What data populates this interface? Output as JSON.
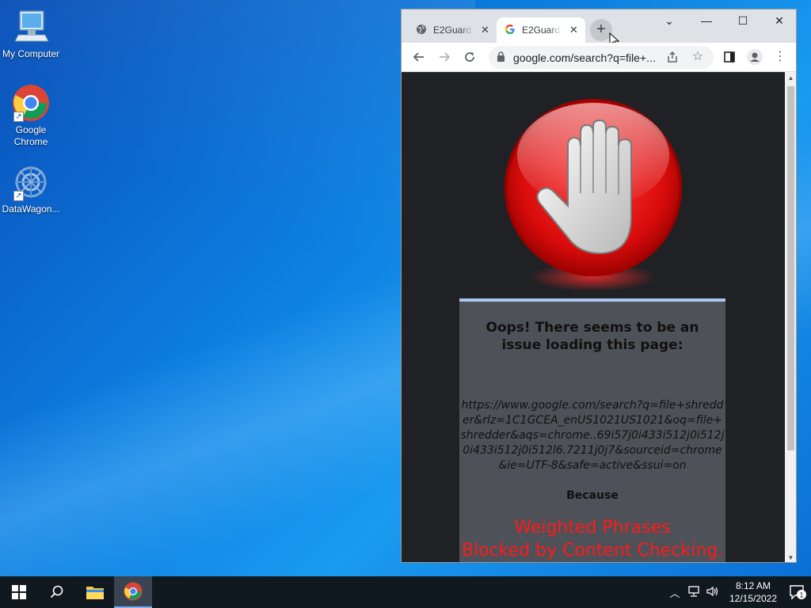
{
  "desktop": {
    "icons": [
      {
        "label": "My Computer",
        "icon": "computer-icon"
      },
      {
        "label": "Google Chrome",
        "icon": "chrome-icon"
      },
      {
        "label": "DataWagon...",
        "icon": "datawagon-icon"
      }
    ]
  },
  "browser": {
    "tabs": [
      {
        "title": "E2Guard",
        "icon": "globe-icon",
        "active": false
      },
      {
        "title": "E2Guard",
        "icon": "google-icon",
        "active": true
      }
    ],
    "new_tab": "+",
    "window_controls": {
      "dropdown": "⌄",
      "minimize": "—",
      "maximize": "☐",
      "close": "✕"
    },
    "address": "google.com/search?q=file+...",
    "page": {
      "title": "Oops! There seems to be an issue loading this page:",
      "url": "https://www.google.com/search?q=file+shredder&rlz=1C1GCEA_enUS1021US1021&oq=file+shredder&aqs=chrome..69i57j0i433i512j0i512j0i433i512j0i512l6.7211j0j7&sourceid=chrome&ie=UTF-8&safe=active&ssui=on",
      "because": "Because",
      "reason_line1": "Weighted Phrases",
      "reason_line2": "Blocked by Content Checking."
    }
  },
  "taskbar": {
    "time": "8:12 AM",
    "date": "12/15/2022",
    "notification_count": "1"
  },
  "colors": {
    "reason_red": "#ff1a1a",
    "message_box": "#4f5158",
    "page_background": "#202124"
  }
}
